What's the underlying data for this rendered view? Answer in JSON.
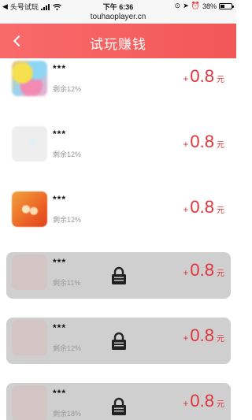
{
  "status_bar": {
    "carrier": "头号试玩",
    "time": "下午 6:36",
    "battery_percent": "38%",
    "battery_level": 0.38
  },
  "url": "touhaoplayer.cn",
  "header": {
    "title": "试玩赚钱",
    "back_icon": "chevron-left-icon"
  },
  "colors": {
    "header": "#f25757",
    "reward": "#e0343b",
    "locked_card": "#cfcfcf"
  },
  "tasks": [
    {
      "name": "***",
      "remain": "剩余12%",
      "plus": "+",
      "reward": "0.8",
      "unit": "元",
      "locked": false
    },
    {
      "name": "***",
      "remain": "剩余12%",
      "plus": "+",
      "reward": "0.8",
      "unit": "元",
      "locked": false
    },
    {
      "name": "***",
      "remain": "剩余12%",
      "plus": "+",
      "reward": "0.8",
      "unit": "元",
      "locked": false
    },
    {
      "name": "***",
      "remain": "剩余11%",
      "plus": "+",
      "reward": "0.8",
      "unit": "元",
      "locked": true
    },
    {
      "name": "***",
      "remain": "剩余12%",
      "plus": "+",
      "reward": "0.8",
      "unit": "元",
      "locked": true
    },
    {
      "name": "***",
      "remain": "剩余18%",
      "plus": "+",
      "reward": "0.8",
      "unit": "元",
      "locked": true
    }
  ]
}
